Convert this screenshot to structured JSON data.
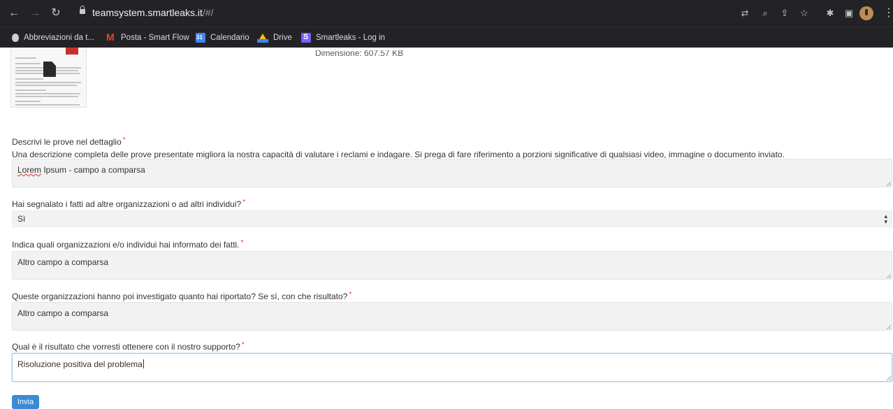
{
  "browser": {
    "url_host": "teamsystem.smartleaks.it",
    "url_path": "/#/",
    "bookmarks": [
      {
        "label": "Abbreviazioni da t...",
        "icon": "apple-icon"
      },
      {
        "label": "Posta - Smart Flow",
        "icon": "gmail-icon"
      },
      {
        "label": "Calendario",
        "icon": "calendar-icon"
      },
      {
        "label": "Drive",
        "icon": "drive-icon"
      },
      {
        "label": "Smartleaks - Log in",
        "icon": "smartleaks-icon"
      }
    ]
  },
  "attachment": {
    "size_text": "Dimensione: 607.57 KB"
  },
  "form": {
    "evidence": {
      "label": "Descrivi le prove nel dettaglio",
      "help": "Una descrizione completa delle prove presentate migliora la nostra capacità di valutare i reclami e indagare. Si prega di fare riferimento a porzioni significative di qualsiasi video, immagine o documento inviato.",
      "value_word1": "Lorem",
      "value_rest": " Ipsum - campo a comparsa"
    },
    "reported": {
      "label": "Hai segnalato i fatti ad altre organizzazioni o ad altri individui?",
      "value": "Sì"
    },
    "informed": {
      "label": "Indica quali organizzazioni e/o individui hai informato dei fatti.",
      "value": "Altro campo a comparsa"
    },
    "investigated": {
      "label": "Queste organizzazioni hanno poi investigato quanto hai riportato? Se sì, con che risultato?",
      "value": "Altro campo a comparsa"
    },
    "outcome": {
      "label": "Qual è il risultato che vorresti ottenere con il nostro supporto?",
      "value": "Risoluzione positiva del problema"
    },
    "required_mark": "*",
    "submit_label": "Invia"
  }
}
